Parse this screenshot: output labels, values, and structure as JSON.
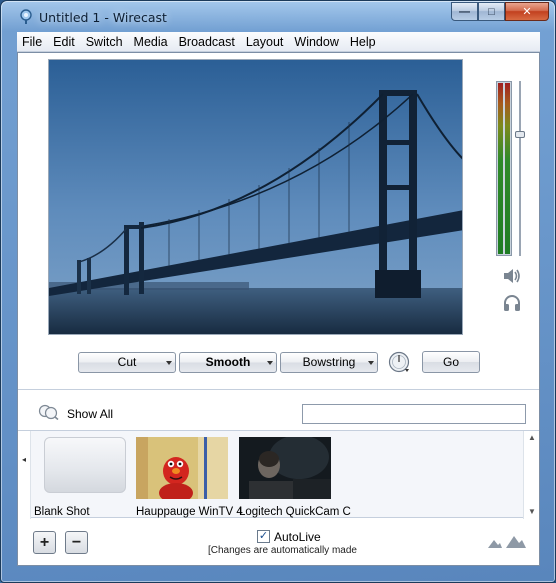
{
  "window": {
    "title": "Untitled 1 - Wirecast",
    "minimize_glyph": "—",
    "maximize_glyph": "□",
    "close_glyph": "✕"
  },
  "menu": [
    "File",
    "Edit",
    "Switch",
    "Media",
    "Broadcast",
    "Layout",
    "Window",
    "Help"
  ],
  "transitions": {
    "cut_label": "Cut",
    "smooth_label": "Smooth",
    "bowstring_label": "Bowstring",
    "go_label": "Go"
  },
  "shots_toolbar": {
    "show_all_label": "Show All",
    "search_value": ""
  },
  "shots": [
    {
      "label": "Blank Shot"
    },
    {
      "label": "Hauppauge WinTV 4"
    },
    {
      "label": "Logitech QuickCam C"
    }
  ],
  "bottom": {
    "add_label": "+",
    "remove_label": "−",
    "autolive_label": "AutoLive",
    "autolive_checked": true,
    "autolive_check_glyph": "✓",
    "autolive_note": "[Changes are automatically made"
  },
  "icons": {
    "app": "wirecast-app-icon",
    "speaker": "speaker-icon",
    "headphones": "headphones-icon",
    "show_all": "show-all-icon",
    "speed": "transition-speed-icon",
    "layer_small": "layer-mountain-small-icon",
    "layer_large": "layer-mountain-large-icon"
  },
  "colors": {
    "window_frame": "#5f8cc3",
    "menubar": "#f0f3f8",
    "close_button": "#c2401f"
  }
}
